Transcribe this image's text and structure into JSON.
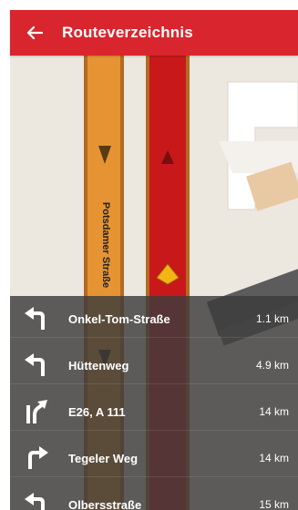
{
  "header": {
    "title": "Routeverzeichnis",
    "back_icon": "arrow-left-icon",
    "color": "#d9252d"
  },
  "map": {
    "street_label": "Potsdamer Straße",
    "route_color": "#c8181a",
    "road_color": "#e69433"
  },
  "directions": [
    {
      "icon": "turn-left-icon",
      "street": "Onkel-Tom-Straße",
      "distance": "1.1 km"
    },
    {
      "icon": "turn-left-icon",
      "street": "Hüttenweg",
      "distance": "4.9 km"
    },
    {
      "icon": "keep-right-fork-icon",
      "street": "E26, A 111",
      "distance": "14 km"
    },
    {
      "icon": "turn-right-icon",
      "street": "Tegeler Weg",
      "distance": "14 km"
    },
    {
      "icon": "turn-left-icon",
      "street": "Olbersstraße",
      "distance": "15 km"
    }
  ]
}
